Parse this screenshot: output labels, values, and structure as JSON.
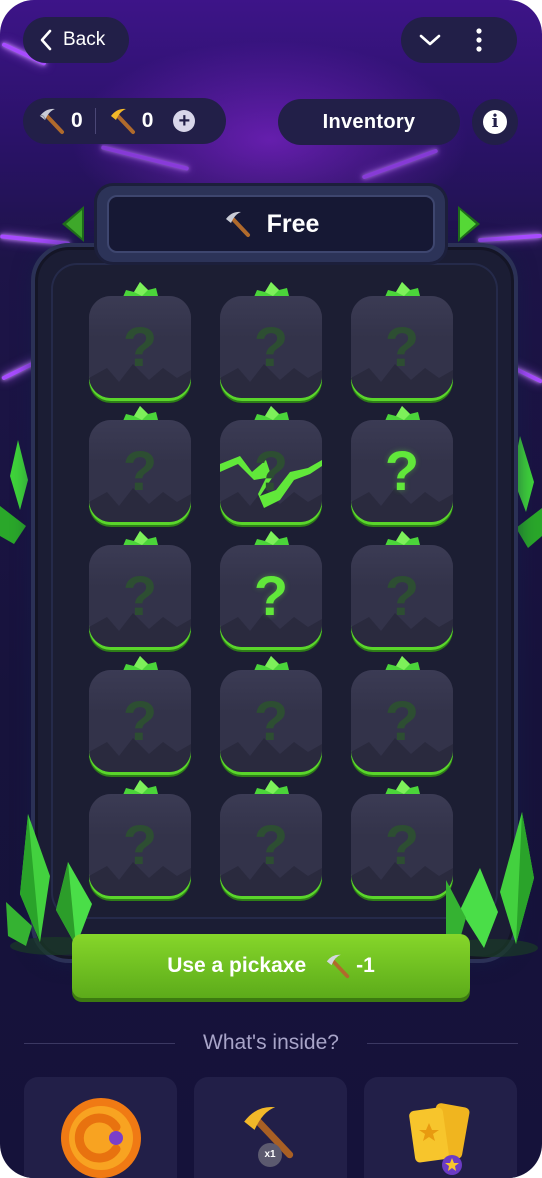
{
  "header": {
    "back_label": "Back"
  },
  "counters": {
    "grey_pickaxe_count": "0",
    "gold_pickaxe_count": "0",
    "add_symbol": "+"
  },
  "inventory_label": "Inventory",
  "info_symbol": "i",
  "mine": {
    "title": "Free"
  },
  "grid": {
    "tiles": [
      "?",
      "?",
      "?",
      "?",
      "?",
      "?",
      "?",
      "?",
      "?",
      "?",
      "?",
      "?",
      "?",
      "?",
      "?"
    ],
    "highlighted_tiles": [
      5,
      7
    ],
    "cracked_tile": 4
  },
  "action": {
    "use_label": "Use a pickaxe",
    "cost": "-1"
  },
  "inside": {
    "heading": "What's inside?",
    "items": [
      {
        "icon": "coin-icon"
      },
      {
        "icon": "pickaxe-icon",
        "badge": "x1"
      },
      {
        "icon": "tickets-icon"
      }
    ]
  },
  "colors": {
    "accent_green": "#7ad02a",
    "panel": "#221f48",
    "neon": "#a74bff"
  }
}
